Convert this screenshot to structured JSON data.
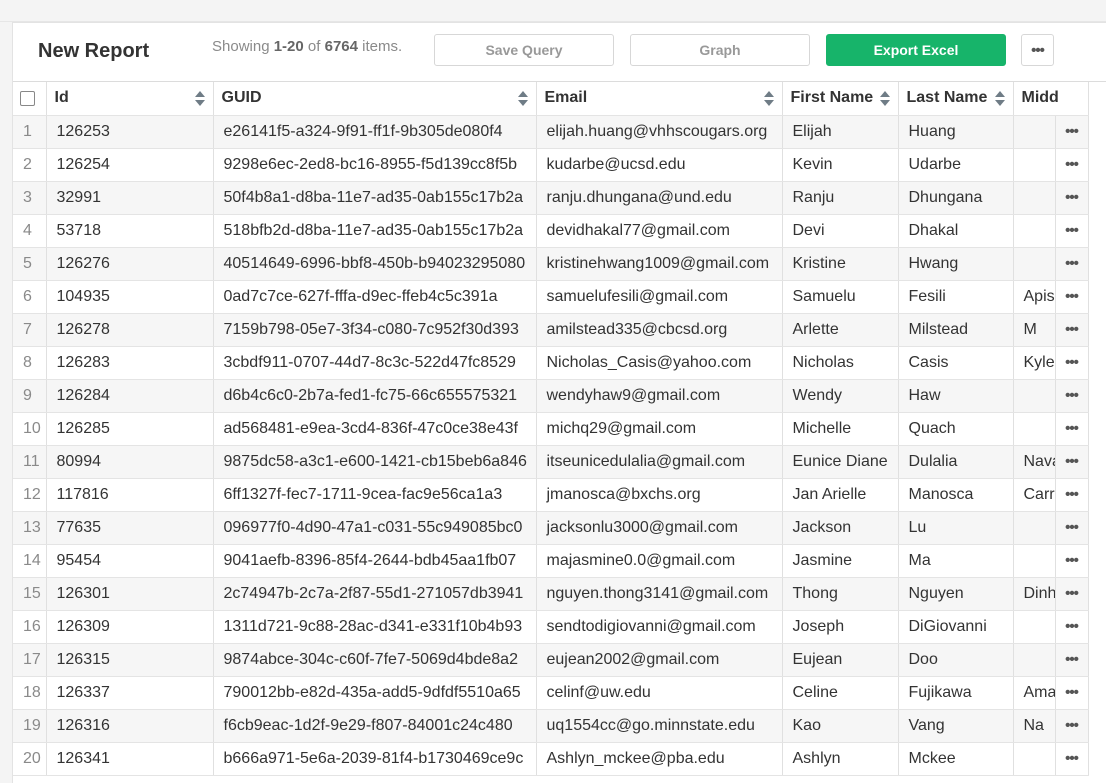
{
  "header": {
    "title": "New Report",
    "showing_prefix": "Showing",
    "range": "1-20",
    "of_word": "of",
    "total": "6764",
    "items_word": "items."
  },
  "buttons": {
    "save_query": "Save Query",
    "graph": "Graph",
    "export_excel": "Export Excel",
    "more": "•••",
    "export_color": "#17b46a"
  },
  "columns": [
    "Id",
    "GUID",
    "Email",
    "First Name",
    "Last Name",
    "Midd"
  ],
  "row_action_label": "•••",
  "rows": [
    {
      "n": "1",
      "id": "126253",
      "guid": "e26141f5-a324-9f91-ff1f-9b305de080f4",
      "email": "elijah.huang@vhhscougars.org",
      "first": "Elijah",
      "last": "Huang",
      "middle": ""
    },
    {
      "n": "2",
      "id": "126254",
      "guid": "9298e6ec-2ed8-bc16-8955-f5d139cc8f5b",
      "email": "kudarbe@ucsd.edu",
      "first": "Kevin",
      "last": "Udarbe",
      "middle": ""
    },
    {
      "n": "3",
      "id": "32991",
      "guid": "50f4b8a1-d8ba-11e7-ad35-0ab155c17b2a",
      "email": "ranju.dhungana@und.edu",
      "first": "Ranju",
      "last": "Dhungana",
      "middle": ""
    },
    {
      "n": "4",
      "id": "53718",
      "guid": "518bfb2d-d8ba-11e7-ad35-0ab155c17b2a",
      "email": "devidhakal77@gmail.com",
      "first": "Devi",
      "last": "Dhakal",
      "middle": ""
    },
    {
      "n": "5",
      "id": "126276",
      "guid": "40514649-6996-bbf8-450b-b94023295080",
      "email": "kristinehwang1009@gmail.com",
      "first": "Kristine",
      "last": "Hwang",
      "middle": ""
    },
    {
      "n": "6",
      "id": "104935",
      "guid": "0ad7c7ce-627f-fffa-d9ec-ffeb4c5c391a",
      "email": "samuelufesili@gmail.com",
      "first": "Samuelu",
      "last": "Fesili",
      "middle": "Apis"
    },
    {
      "n": "7",
      "id": "126278",
      "guid": "7159b798-05e7-3f34-c080-7c952f30d393",
      "email": "amilstead335@cbcsd.org",
      "first": "Arlette",
      "last": "Milstead",
      "middle": "M"
    },
    {
      "n": "8",
      "id": "126283",
      "guid": "3cbdf911-0707-44d7-8c3c-522d47fc8529",
      "email": "Nicholas_Casis@yahoo.com",
      "first": "Nicholas",
      "last": "Casis",
      "middle": "Kyle"
    },
    {
      "n": "9",
      "id": "126284",
      "guid": "d6b4c6c0-2b7a-fed1-fc75-66c655575321",
      "email": "wendyhaw9@gmail.com",
      "first": "Wendy",
      "last": "Haw",
      "middle": ""
    },
    {
      "n": "10",
      "id": "126285",
      "guid": "ad568481-e9ea-3cd4-836f-47c0ce38e43f",
      "email": "michq29@gmail.com",
      "first": "Michelle",
      "last": "Quach",
      "middle": ""
    },
    {
      "n": "11",
      "id": "80994",
      "guid": "9875dc58-a3c1-e600-1421-cb15beb6a846",
      "email": "itseunicedulalia@gmail.com",
      "first": "Eunice Diane",
      "last": "Dulalia",
      "middle": "Nava"
    },
    {
      "n": "12",
      "id": "117816",
      "guid": "6ff1327f-fec7-1711-9cea-fac9e56ca1a3",
      "email": "jmanosca@bxchs.org",
      "first": "Jan Arielle",
      "last": "Manosca",
      "middle": "Carre"
    },
    {
      "n": "13",
      "id": "77635",
      "guid": "096977f0-4d90-47a1-c031-55c949085bc0",
      "email": "jacksonlu3000@gmail.com",
      "first": "Jackson",
      "last": "Lu",
      "middle": ""
    },
    {
      "n": "14",
      "id": "95454",
      "guid": "9041aefb-8396-85f4-2644-bdb45aa1fb07",
      "email": "majasmine0.0@gmail.com",
      "first": "Jasmine",
      "last": "Ma",
      "middle": ""
    },
    {
      "n": "15",
      "id": "126301",
      "guid": "2c74947b-2c7a-2f87-55d1-271057db3941",
      "email": "nguyen.thong3141@gmail.com",
      "first": "Thong",
      "last": "Nguyen",
      "middle": "Dinh"
    },
    {
      "n": "16",
      "id": "126309",
      "guid": "1311d721-9c88-28ac-d341-e331f10b4b93",
      "email": "sendtodigiovanni@gmail.com",
      "first": "Joseph",
      "last": "DiGiovanni",
      "middle": ""
    },
    {
      "n": "17",
      "id": "126315",
      "guid": "9874abce-304c-c60f-7fe7-5069d4bde8a2",
      "email": "eujean2002@gmail.com",
      "first": "Eujean",
      "last": "Doo",
      "middle": ""
    },
    {
      "n": "18",
      "id": "126337",
      "guid": "790012bb-e82d-435a-add5-9dfdf5510a65",
      "email": "celinf@uw.edu",
      "first": "Celine",
      "last": "Fujikawa",
      "middle": "Ama"
    },
    {
      "n": "19",
      "id": "126316",
      "guid": "f6cb9eac-1d2f-9e29-f807-84001c24c480",
      "email": "uq1554cc@go.minnstate.edu",
      "first": "Kao",
      "last": "Vang",
      "middle": "Na"
    },
    {
      "n": "20",
      "id": "126341",
      "guid": "b666a971-5e6a-2039-81f4-b1730469ce9c",
      "email": "Ashlyn_mckee@pba.edu",
      "first": "Ashlyn",
      "last": "Mckee",
      "middle": ""
    }
  ]
}
